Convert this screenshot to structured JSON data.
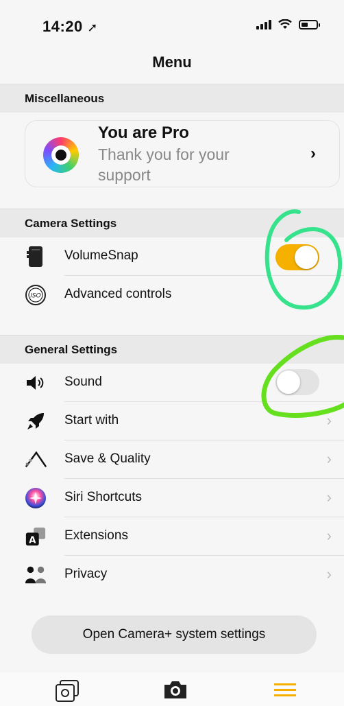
{
  "status": {
    "time": "14:20"
  },
  "nav": {
    "title": "Menu"
  },
  "sections": {
    "misc": "Miscellaneous",
    "camera": "Camera Settings",
    "general": "General Settings"
  },
  "pro": {
    "title": "You are Pro",
    "subtitle": "Thank you for your support",
    "chevron": "›"
  },
  "camera_items": [
    {
      "label": "VolumeSnap",
      "toggle": "on",
      "icon": "phone-icon"
    },
    {
      "label": "Advanced controls",
      "icon": "iso-icon"
    }
  ],
  "general_items": [
    {
      "label": "Sound",
      "toggle": "off",
      "icon": "speaker-icon"
    },
    {
      "label": "Start with",
      "icon": "rocket-icon"
    },
    {
      "label": "Save & Quality",
      "icon": "quality-icon"
    },
    {
      "label": "Siri Shortcuts",
      "icon": "siri-icon"
    },
    {
      "label": "Extensions",
      "icon": "extensions-icon"
    },
    {
      "label": "Privacy",
      "icon": "privacy-icon"
    }
  ],
  "chevron": "›",
  "open_settings_label": "Open Camera+ system settings",
  "tabs": [
    {
      "icon": "gallery-icon"
    },
    {
      "icon": "camera-icon"
    },
    {
      "icon": "menu-icon"
    }
  ],
  "colors": {
    "accent": "#f5b000",
    "annotation_green": "#36e38c",
    "annotation_lime": "#66e01e"
  }
}
